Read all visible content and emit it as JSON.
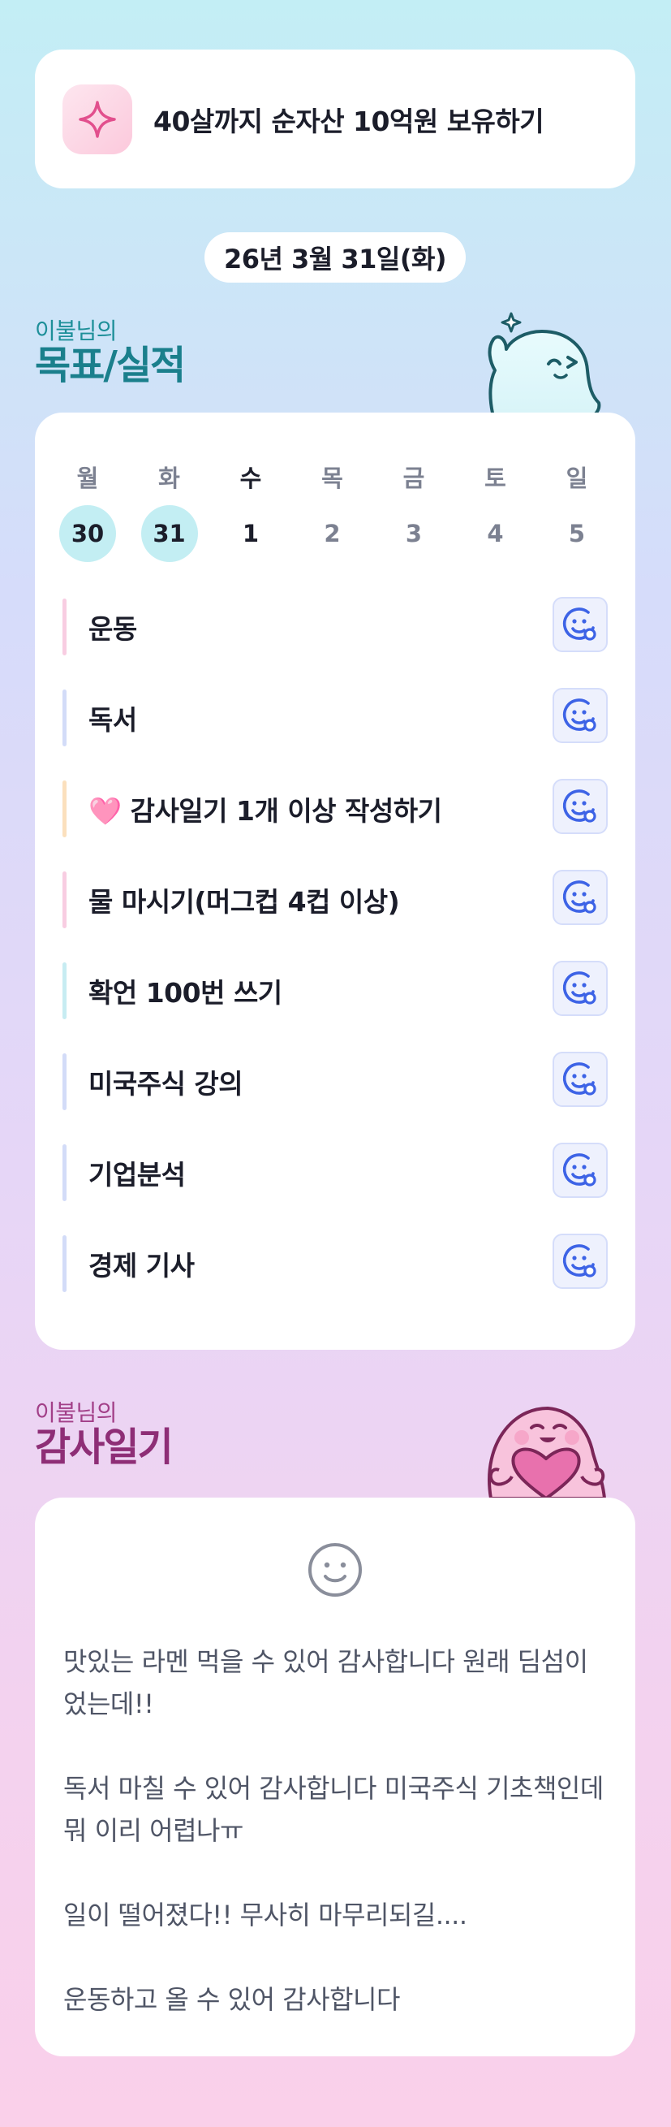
{
  "goal": {
    "icon": "sparkle-icon",
    "text": "40살까지 순자산 10억원 보유하기"
  },
  "date": "26년 3월 31일(화)",
  "goals_section": {
    "subtitle": "이불님의",
    "title": "목표/실적",
    "week": [
      {
        "day": "월",
        "date": "30",
        "state": "past"
      },
      {
        "day": "화",
        "date": "31",
        "state": "past"
      },
      {
        "day": "수",
        "date": "1",
        "state": "today"
      },
      {
        "day": "목",
        "date": "2",
        "state": "future"
      },
      {
        "day": "금",
        "date": "3",
        "state": "future"
      },
      {
        "day": "토",
        "date": "4",
        "state": "future"
      },
      {
        "day": "일",
        "date": "5",
        "state": "future"
      }
    ],
    "tasks": [
      {
        "label": "운동",
        "bar_color": "#f8cde2",
        "button_icon": "smile-add-icon"
      },
      {
        "label": "독서",
        "bar_color": "#d3dcf8",
        "button_icon": "smile-add-icon"
      },
      {
        "label": "🩷 감사일기 1개 이상 작성하기",
        "bar_color": "#fbe0bd",
        "button_icon": "smile-add-icon"
      },
      {
        "label": "물 마시기(머그컵 4컵 이상)",
        "bar_color": "#f8cde2",
        "button_icon": "smile-add-icon"
      },
      {
        "label": "확언 100번 쓰기",
        "bar_color": "#c7ecf2",
        "button_icon": "smile-add-icon"
      },
      {
        "label": "미국주식 강의",
        "bar_color": "#d3dcf8",
        "button_icon": "smile-add-icon"
      },
      {
        "label": "기업분석",
        "bar_color": "#d3dcf8",
        "button_icon": "smile-add-icon"
      },
      {
        "label": "경제 기사",
        "bar_color": "#d3dcf8",
        "button_icon": "smile-add-icon"
      }
    ]
  },
  "gratitude_section": {
    "subtitle": "이불님의",
    "title": "감사일기",
    "icon": "smile-face-icon",
    "entries": [
      "맛있는 라멘 먹을 수 있어 감사합니다 원래 딤섬이었는데!!",
      "독서 마칠 수 있어 감사합니다 미국주식 기초책인데 뭐 이리 어렵나ㅠ",
      "일이 떨어졌다!! 무사히 마무리되길....",
      "운동하고 올 수 있어 감사합니다"
    ]
  },
  "colors": {
    "accent_teal": "#1a7f8c",
    "accent_magenta": "#8e2e76",
    "button_blue": "#3d63e6",
    "past_day_bg": "#c3eef3"
  }
}
